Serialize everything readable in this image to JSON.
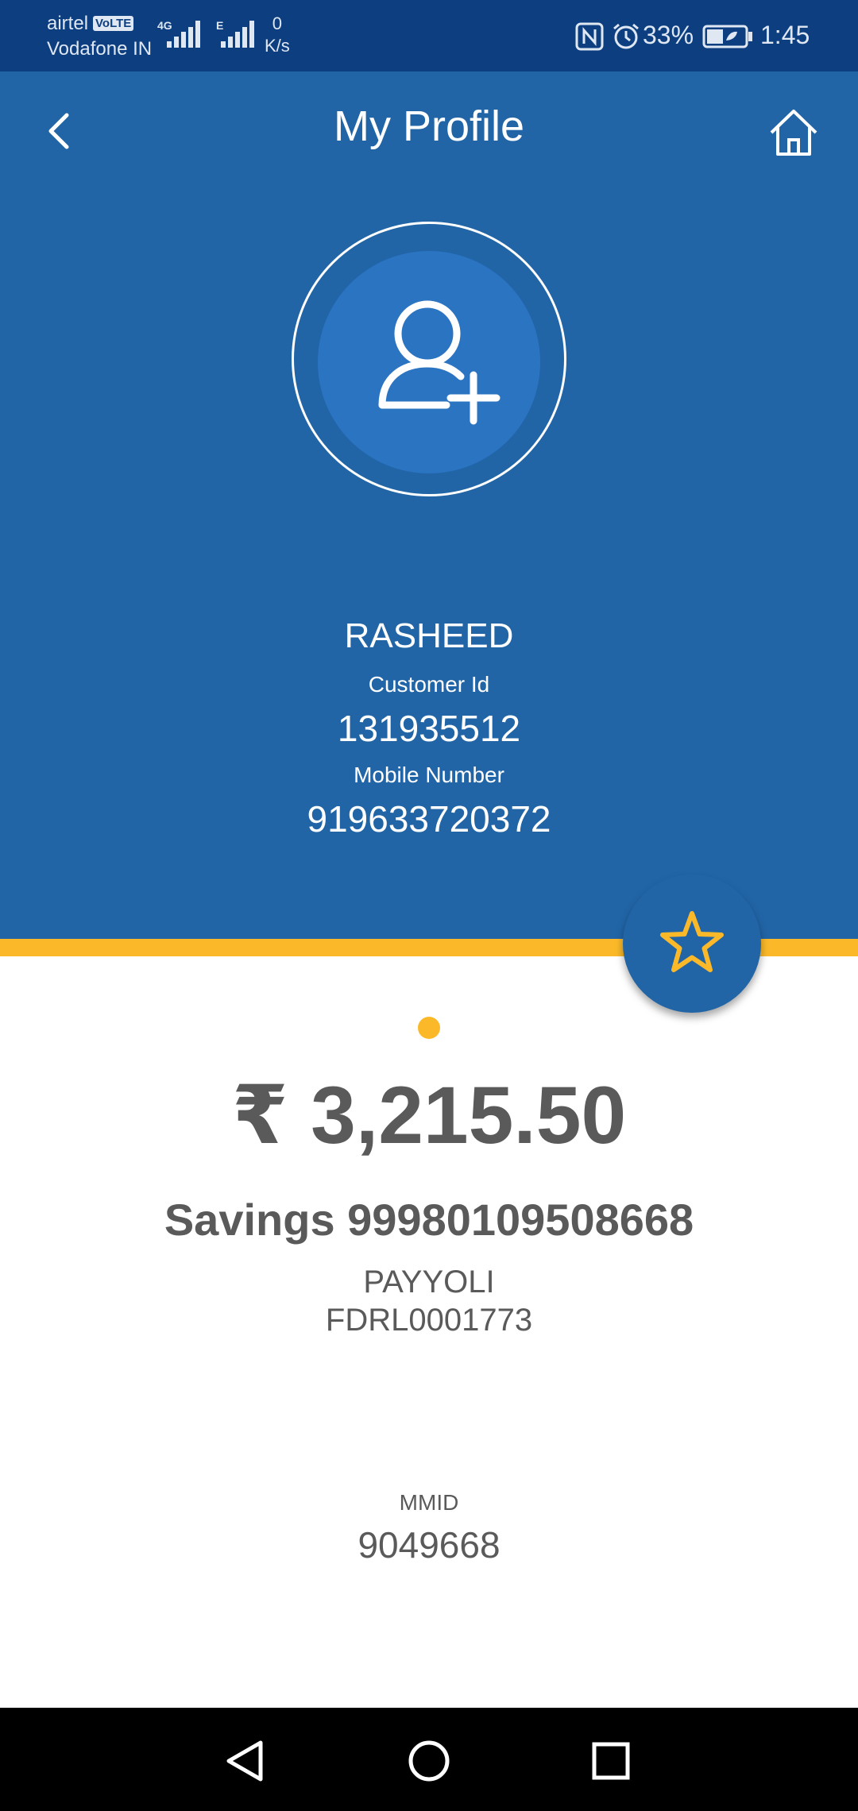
{
  "status_bar": {
    "carrier_1": "airtel",
    "volte_badge": "VoLTE",
    "carrier_2": "Vodafone IN",
    "network_1": "4G",
    "network_2": "E",
    "speed_value": "0",
    "speed_unit": "K/s",
    "battery": "33%",
    "time": "1:45"
  },
  "header": {
    "title": "My Profile"
  },
  "profile": {
    "name": "RASHEED",
    "customer_id_label": "Customer Id",
    "customer_id": "131935512",
    "mobile_label": "Mobile Number",
    "mobile": "919633720372"
  },
  "account": {
    "balance": "₹ 3,215.50",
    "account_line": "Savings 99980109508668",
    "branch": "PAYYOLI",
    "ifsc": "FDRL0001773",
    "mmid_label": "MMID",
    "mmid": "9049668"
  },
  "colors": {
    "status_bar": "#0d3f80",
    "header_blue": "#2165a7",
    "accent_yellow": "#fbb92a",
    "text_gray": "#5a5a5a"
  },
  "icons": {
    "back": "chevron-left-icon",
    "home": "home-icon",
    "avatar": "add-user-icon",
    "favorite": "star-icon"
  }
}
